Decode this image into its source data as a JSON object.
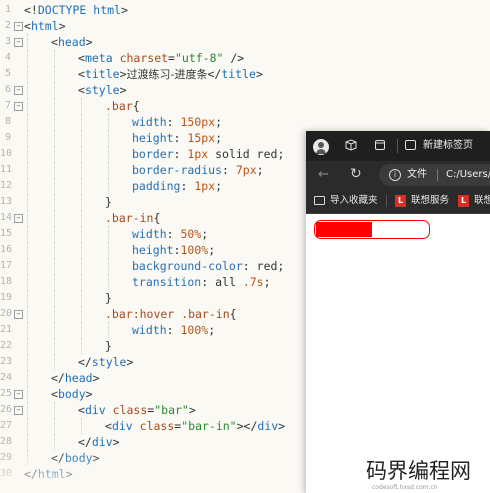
{
  "editor": {
    "lines": [
      {
        "n": "1",
        "fold": "",
        "indent": 0,
        "tokens": [
          [
            "pun",
            "<!"
          ],
          [
            "tag",
            "DOCTYPE"
          ],
          [
            "pun",
            " "
          ],
          [
            "tag",
            "html"
          ],
          [
            "pun",
            ">"
          ]
        ]
      },
      {
        "n": "2",
        "fold": "⊟",
        "indent": 0,
        "tokens": [
          [
            "pun",
            "<"
          ],
          [
            "tag",
            "html"
          ],
          [
            "pun",
            ">"
          ]
        ]
      },
      {
        "n": "3",
        "fold": "⊟",
        "indent": 1,
        "tokens": [
          [
            "pun",
            "<"
          ],
          [
            "tag",
            "head"
          ],
          [
            "pun",
            ">"
          ]
        ]
      },
      {
        "n": "4",
        "fold": "",
        "indent": 2,
        "tokens": [
          [
            "pun",
            "<"
          ],
          [
            "tag",
            "meta"
          ],
          [
            "pun",
            " "
          ],
          [
            "attr",
            "charset"
          ],
          [
            "pun",
            "="
          ],
          [
            "str",
            "\"utf-8\""
          ],
          [
            "pun",
            " />"
          ]
        ]
      },
      {
        "n": "5",
        "fold": "",
        "indent": 2,
        "tokens": [
          [
            "pun",
            "<"
          ],
          [
            "tag",
            "title"
          ],
          [
            "pun",
            ">"
          ],
          [
            "cn",
            "过渡练习-进度条"
          ],
          [
            "pun",
            "</"
          ],
          [
            "tag",
            "title"
          ],
          [
            "pun",
            ">"
          ]
        ]
      },
      {
        "n": "6",
        "fold": "⊟",
        "indent": 2,
        "tokens": [
          [
            "pun",
            "<"
          ],
          [
            "tag",
            "style"
          ],
          [
            "pun",
            ">"
          ]
        ]
      },
      {
        "n": "7",
        "fold": "⊟",
        "indent": 3,
        "tokens": [
          [
            "sel",
            ".bar"
          ],
          [
            "pun",
            "{"
          ]
        ]
      },
      {
        "n": "8",
        "fold": "",
        "indent": 4,
        "tokens": [
          [
            "prop",
            "width"
          ],
          [
            "pun",
            ": "
          ],
          [
            "num",
            "150px"
          ],
          [
            "pun",
            ";"
          ]
        ]
      },
      {
        "n": "9",
        "fold": "",
        "indent": 4,
        "tokens": [
          [
            "prop",
            "height"
          ],
          [
            "pun",
            ": "
          ],
          [
            "num",
            "15px"
          ],
          [
            "pun",
            ";"
          ]
        ]
      },
      {
        "n": "10",
        "fold": "",
        "indent": 4,
        "tokens": [
          [
            "prop",
            "border"
          ],
          [
            "pun",
            ": "
          ],
          [
            "num",
            "1px"
          ],
          [
            "val",
            " solid red"
          ],
          [
            "pun",
            ";"
          ]
        ]
      },
      {
        "n": "11",
        "fold": "",
        "indent": 4,
        "tokens": [
          [
            "prop",
            "border-radius"
          ],
          [
            "pun",
            ": "
          ],
          [
            "num",
            "7px"
          ],
          [
            "pun",
            ";"
          ]
        ]
      },
      {
        "n": "12",
        "fold": "",
        "indent": 4,
        "tokens": [
          [
            "prop",
            "padding"
          ],
          [
            "pun",
            ": "
          ],
          [
            "num",
            "1px"
          ],
          [
            "pun",
            ";"
          ]
        ]
      },
      {
        "n": "13",
        "fold": "",
        "indent": 3,
        "tokens": [
          [
            "pun",
            "}"
          ]
        ]
      },
      {
        "n": "14",
        "fold": "⊟",
        "indent": 3,
        "tokens": [
          [
            "sel",
            ".bar-in"
          ],
          [
            "pun",
            "{"
          ]
        ]
      },
      {
        "n": "15",
        "fold": "",
        "indent": 4,
        "tokens": [
          [
            "prop",
            "width"
          ],
          [
            "pun",
            ": "
          ],
          [
            "num",
            "50%"
          ],
          [
            "pun",
            ";"
          ]
        ]
      },
      {
        "n": "16",
        "fold": "",
        "indent": 4,
        "tokens": [
          [
            "prop",
            "height"
          ],
          [
            "pun",
            ":"
          ],
          [
            "num",
            "100%"
          ],
          [
            "pun",
            ";"
          ]
        ]
      },
      {
        "n": "17",
        "fold": "",
        "indent": 4,
        "tokens": [
          [
            "prop",
            "background-color"
          ],
          [
            "pun",
            ": "
          ],
          [
            "val",
            "red"
          ],
          [
            "pun",
            ";"
          ]
        ]
      },
      {
        "n": "18",
        "fold": "",
        "indent": 4,
        "tokens": [
          [
            "prop",
            "transition"
          ],
          [
            "pun",
            ": "
          ],
          [
            "val",
            "all "
          ],
          [
            "num",
            ".7s"
          ],
          [
            "pun",
            ";"
          ]
        ]
      },
      {
        "n": "19",
        "fold": "",
        "indent": 3,
        "tokens": [
          [
            "pun",
            "}"
          ]
        ]
      },
      {
        "n": "20",
        "fold": "⊟",
        "indent": 3,
        "tokens": [
          [
            "sel",
            ".bar:hover .bar-in"
          ],
          [
            "pun",
            "{"
          ]
        ]
      },
      {
        "n": "21",
        "fold": "",
        "indent": 4,
        "tokens": [
          [
            "prop",
            "width"
          ],
          [
            "pun",
            ": "
          ],
          [
            "num",
            "100%"
          ],
          [
            "pun",
            ";"
          ]
        ]
      },
      {
        "n": "22",
        "fold": "",
        "indent": 3,
        "tokens": [
          [
            "pun",
            "}"
          ]
        ]
      },
      {
        "n": "23",
        "fold": "",
        "indent": 2,
        "tokens": [
          [
            "pun",
            "</"
          ],
          [
            "tag",
            "style"
          ],
          [
            "pun",
            ">"
          ]
        ]
      },
      {
        "n": "24",
        "fold": "",
        "indent": 1,
        "tokens": [
          [
            "pun",
            "</"
          ],
          [
            "tag",
            "head"
          ],
          [
            "pun",
            ">"
          ]
        ]
      },
      {
        "n": "25",
        "fold": "⊟",
        "indent": 1,
        "tokens": [
          [
            "pun",
            "<"
          ],
          [
            "tag",
            "body"
          ],
          [
            "pun",
            ">"
          ]
        ]
      },
      {
        "n": "26",
        "fold": "⊟",
        "indent": 2,
        "tokens": [
          [
            "pun",
            "<"
          ],
          [
            "tag",
            "div"
          ],
          [
            "pun",
            " "
          ],
          [
            "attr",
            "class"
          ],
          [
            "pun",
            "="
          ],
          [
            "str",
            "\"bar\""
          ],
          [
            "pun",
            ">"
          ]
        ]
      },
      {
        "n": "27",
        "fold": "",
        "indent": 3,
        "tokens": [
          [
            "pun",
            "<"
          ],
          [
            "tag",
            "div"
          ],
          [
            "pun",
            " "
          ],
          [
            "attr",
            "class"
          ],
          [
            "pun",
            "="
          ],
          [
            "str",
            "\"bar-in\""
          ],
          [
            "pun",
            "></"
          ],
          [
            "tag",
            "div"
          ],
          [
            "pun",
            ">"
          ]
        ]
      },
      {
        "n": "28",
        "fold": "",
        "indent": 2,
        "tokens": [
          [
            "pun",
            "</"
          ],
          [
            "tag",
            "div"
          ],
          [
            "pun",
            ">"
          ]
        ]
      },
      {
        "n": "29",
        "fold": "",
        "indent": 1,
        "tokens": [
          [
            "pun",
            "</"
          ],
          [
            "tag",
            "body"
          ],
          [
            "pun",
            ">"
          ]
        ]
      },
      {
        "n": "30",
        "fold": "",
        "indent": 0,
        "tokens": [
          [
            "pun",
            "</"
          ],
          [
            "tag",
            "html"
          ],
          [
            "pun",
            ">"
          ]
        ]
      }
    ]
  },
  "browser": {
    "tab_title": "新建标签页",
    "address": {
      "scheme_label": "文件",
      "url": "C:/Users/"
    },
    "bookmarks": [
      {
        "label": "导入收藏夹",
        "icon": "folder-icon"
      },
      {
        "label": "联想服务",
        "icon": "lenovo-logo-icon",
        "logo": "L"
      },
      {
        "label": "联想",
        "icon": "lenovo-logo-icon",
        "logo": "L"
      }
    ],
    "progress": {
      "value": 0.5
    }
  },
  "watermark": {
    "text": "码界编程网",
    "sub": "codesoft.hxsd.com.cn"
  },
  "colors": {
    "tag": "#1f6fb5",
    "attr": "#a34a1f",
    "string": "#2a8a2a",
    "number": "#b5541b",
    "progress_fill": "#ff0000"
  }
}
